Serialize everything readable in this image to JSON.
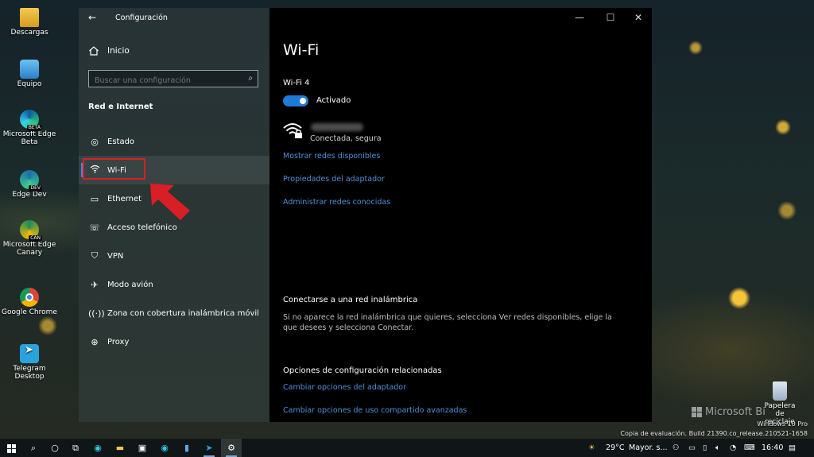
{
  "desktop": {
    "icons": [
      {
        "label": "Descargas",
        "icon": "downloads-folder-icon"
      },
      {
        "label": "Equipo",
        "icon": "this-pc-icon"
      },
      {
        "label": "Microsoft Edge Beta",
        "icon": "edge-beta-icon",
        "badge": "BETA"
      },
      {
        "label": "Edge Dev",
        "icon": "edge-dev-icon",
        "badge": "DEV"
      },
      {
        "label": "Microsoft Edge Canary",
        "icon": "edge-canary-icon",
        "badge": "CAN"
      },
      {
        "label": "Google Chrome",
        "icon": "chrome-icon"
      },
      {
        "label": "Telegram Desktop",
        "icon": "telegram-icon"
      },
      {
        "label": "Papelera de reciclaje",
        "icon": "recycle-bin-icon"
      }
    ]
  },
  "window": {
    "title": "Configuración",
    "controls": {
      "minimize": "—",
      "maximize": "☐",
      "close": "✕"
    }
  },
  "sidebar": {
    "home_label": "Inicio",
    "search_placeholder": "Buscar una configuración",
    "section_title": "Red e Internet",
    "items": [
      {
        "label": "Estado",
        "icon": "globe-icon"
      },
      {
        "label": "Wi-Fi",
        "icon": "wifi-icon",
        "active": true
      },
      {
        "label": "Ethernet",
        "icon": "ethernet-icon"
      },
      {
        "label": "Acceso telefónico",
        "icon": "dialup-icon"
      },
      {
        "label": "VPN",
        "icon": "vpn-icon"
      },
      {
        "label": "Modo avión",
        "icon": "airplane-icon"
      },
      {
        "label": "Zona con cobertura inalámbrica móvil",
        "icon": "hotspot-icon"
      },
      {
        "label": "Proxy",
        "icon": "proxy-globe-icon"
      }
    ]
  },
  "main": {
    "title": "Wi-Fi",
    "adapter_name": "Wi-Fi 4",
    "toggle_state": "Activado",
    "connection_status": "Conectada, segura",
    "links": [
      "Mostrar redes disponibles",
      "Propiedades del adaptador",
      "Administrar redes conocidas"
    ],
    "connect_heading": "Conectarse a una red inalámbrica",
    "connect_text": "Si no aparece la red inalámbrica que quieres, selecciona Ver redes disponibles, elige la que desees y selecciona Conectar.",
    "related_heading": "Opciones de configuración relacionadas",
    "related_links": [
      "Cambiar opciones del adaptador",
      "Cambiar opciones de uso compartido avanzadas"
    ]
  },
  "watermark": {
    "brand": "Microsoft Bi",
    "edition": "Windows 10 Pro",
    "build": "Copia de evaluación. Build 21390.co_release.210521-1658"
  },
  "taskbar": {
    "weather_temp": "29°C",
    "weather_text": "Mayor. s...",
    "time": "16:40"
  },
  "colors": {
    "accent": "#1f7ad6",
    "link": "#4f8fd8",
    "highlight_box": "#d81f26"
  }
}
